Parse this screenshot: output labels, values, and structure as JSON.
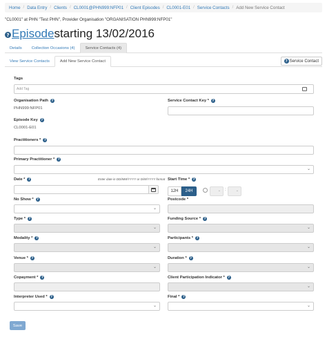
{
  "breadcrumb": [
    "Home",
    "Data Entry",
    "Clients",
    "CL0001@PHN999:NFP01",
    "Client Episodes",
    "CL0001-E01",
    "Service Contacts",
    "Add New Service Contact"
  ],
  "context_line": "\"CL0001\" at PHN \"Test PHN\", Provider Organisation \"ORGANISATION PHN999:NFP01\"",
  "title": {
    "link": "Episode",
    "rest": " starting 13/02/2016"
  },
  "tabs": [
    "Details",
    "Collection Occasions (4)",
    "Service Contacts (4)"
  ],
  "subtabs": [
    "View Service Contacts",
    "Add New Service Contact"
  ],
  "service_contact_button": "Service Contact",
  "form": {
    "tags": {
      "label": "Tags",
      "placeholder": "Add Tag"
    },
    "org_path": {
      "label": "Organisation Path",
      "value": "PHN999:NFP01"
    },
    "service_contact_key": {
      "label": "Service Contact Key *"
    },
    "episode_key": {
      "label": "Episode Key",
      "value": "CL0001-E01"
    },
    "practitioners": {
      "label": "Practitioners *"
    },
    "primary_practitioner": {
      "label": "Primary Practitioner *"
    },
    "date": {
      "label": "Date *",
      "hint": "Enter date in DD/MM/YYYY or D/M/YYYY format"
    },
    "start_time": {
      "label": "Start Time *",
      "opt_12h": "12H",
      "opt_24h": "24H",
      "selected": "24H",
      "separator": ":"
    },
    "no_show": {
      "label": "No Show *"
    },
    "postcode": {
      "label": "Postcode *"
    },
    "type": {
      "label": "Type *"
    },
    "funding_source": {
      "label": "Funding Source *"
    },
    "modality": {
      "label": "Modality *"
    },
    "participants": {
      "label": "Participants *"
    },
    "venue": {
      "label": "Venue *"
    },
    "duration": {
      "label": "Duration *"
    },
    "copayment": {
      "label": "Copayment *"
    },
    "client_participation": {
      "label": "Client Participation Indicator *"
    },
    "interpreter": {
      "label": "Interpreter Used *"
    },
    "final": {
      "label": "Final *"
    }
  },
  "save_label": "Save",
  "colors": {
    "link": "#337ab7",
    "primary": "#2c5f8a",
    "save": "#7fa8d1"
  }
}
